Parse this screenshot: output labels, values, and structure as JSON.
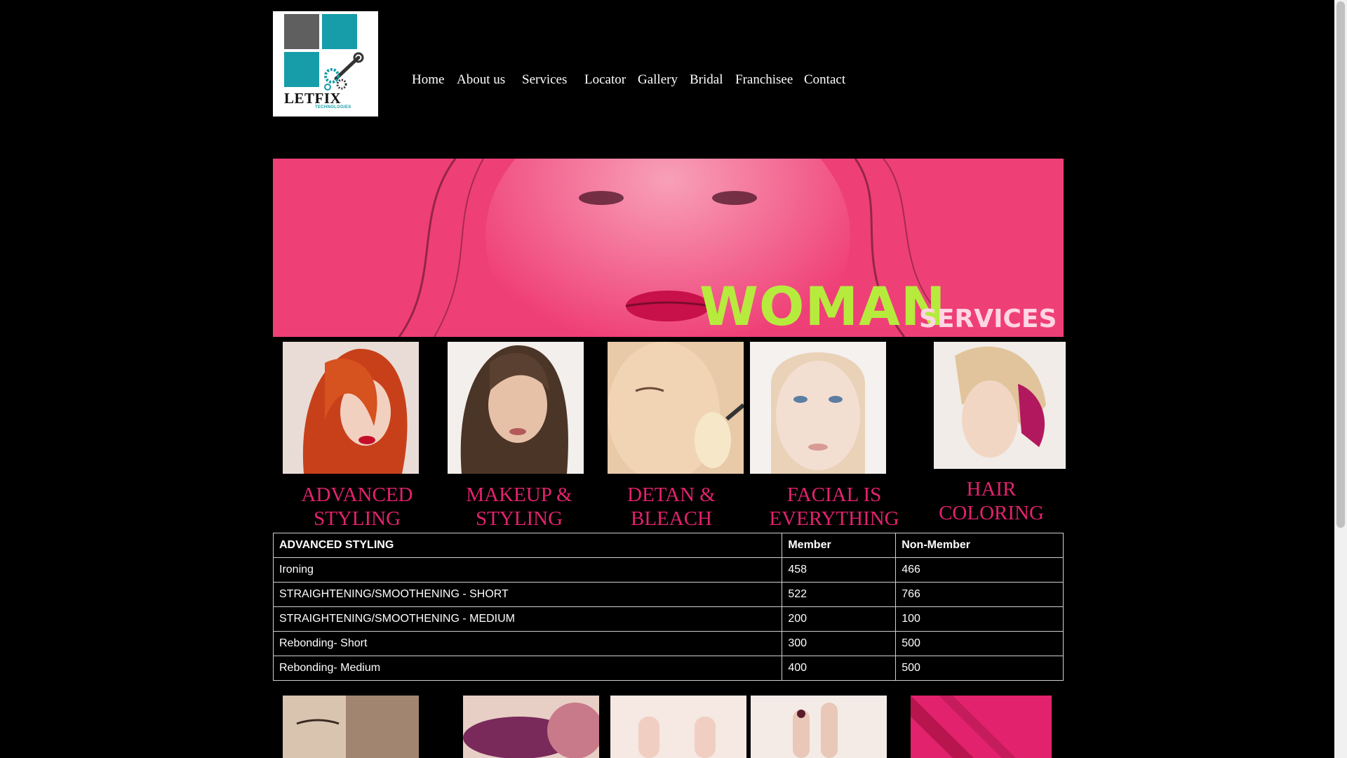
{
  "logo": {
    "brand": "LETFIX",
    "tagline": "TECHNOLOGIES"
  },
  "nav": {
    "items": [
      "Home",
      "About us",
      "Services",
      "Locator",
      "Gallery",
      "Bridal",
      "Franchisee",
      "Contact"
    ]
  },
  "banner": {
    "title": "WOMAN",
    "subtitle": "SERVICES"
  },
  "services": [
    {
      "label_line1": "ADVANCED",
      "label_line2": "STYLING"
    },
    {
      "label_line1": "MAKEUP &",
      "label_line2": "STYLING"
    },
    {
      "label_line1": "DETAN &",
      "label_line2": "BLEACH"
    },
    {
      "label_line1": "FACIAL IS",
      "label_line2": "EVERYTHING"
    },
    {
      "label_line1": "HAIR",
      "label_line2": "COLORING"
    }
  ],
  "price_table": {
    "headers": [
      "ADVANCED STYLING",
      "Member",
      "Non-Member"
    ],
    "rows": [
      [
        "Ironing",
        "458",
        "466"
      ],
      [
        "STRAIGHTENING/SMOOTHENING - SHORT",
        "522",
        "766"
      ],
      [
        "STRAIGHTENING/SMOOTHENING - MEDIUM",
        "200",
        "100"
      ],
      [
        "Rebonding- Short",
        "300",
        "500"
      ],
      [
        "Rebonding- Medium",
        "400",
        "500"
      ]
    ]
  },
  "colors": {
    "background": "#000000",
    "accent_pink": "#e3226d",
    "banner_pink": "#ef3f77",
    "banner_title_green": "#b6eb3e",
    "logo_teal": "#169da9",
    "logo_gray": "#5f5f5f"
  }
}
